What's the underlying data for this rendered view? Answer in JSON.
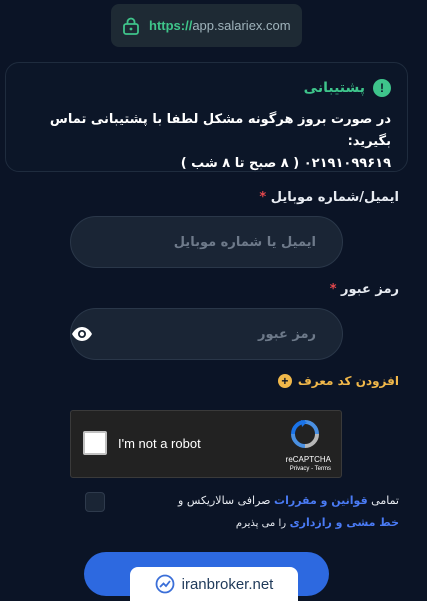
{
  "browser": {
    "url_scheme": "https://",
    "url_host": "app.salariex.com"
  },
  "support": {
    "title": "پشتیبانی",
    "message_line1": "در صورت بروز هرگونه مشکل لطفا با پشتیبانی تماس بگیرید:",
    "message_line2": "۰۲۱۹۱۰۹۹۶۱۹ ( ۸ صبح تا ۸ شب )"
  },
  "form": {
    "email_label": "ایمیل/شماره موبایل",
    "email_placeholder": "ایمیل یا شماره موبایل",
    "password_label": "رمز عبور",
    "password_placeholder": "رمز عبور",
    "required_mark": "*",
    "referral_label": "افزودن کد معرف",
    "referral_icon": "+",
    "terms_prefix": "تمامی",
    "terms_link1": "قوانین و مقررات",
    "terms_middle": "صرافی سالاریکس و",
    "terms_link2": "خط مشی و رازداری",
    "terms_suffix": "را می پذیرم"
  },
  "captcha": {
    "label": "I'm not a robot",
    "brand": "reCAPTCHA",
    "links": "Privacy - Terms"
  },
  "watermark": {
    "text": "iranbroker.net"
  },
  "colors": {
    "background": "#0b1426",
    "accent_green": "#3ec48b",
    "accent_blue": "#2d69e0",
    "referral_gold": "#f1b84a",
    "required_red": "#e5484d"
  },
  "icons": {
    "lock": "lock-icon",
    "info": "info-icon",
    "eye": "eye-icon",
    "plus": "plus-circle-icon",
    "recaptcha": "recaptcha-icon",
    "watermark": "chart-icon"
  }
}
